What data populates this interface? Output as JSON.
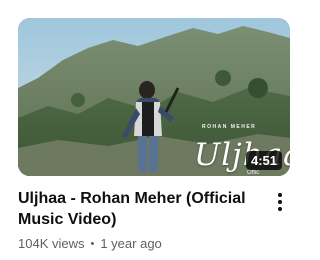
{
  "video": {
    "title": "Uljhaa - Rohan Meher (Official Music Video)",
    "views": "104K views",
    "separator": "•",
    "age": "1 year ago",
    "duration": "4:51"
  },
  "thumbnail": {
    "overlay_artist": "ROHAN MEHER",
    "overlay_title": "Uljhaa",
    "overlay_subtitle": "Offic"
  },
  "icons": {
    "more": "more-vertical-icon"
  }
}
